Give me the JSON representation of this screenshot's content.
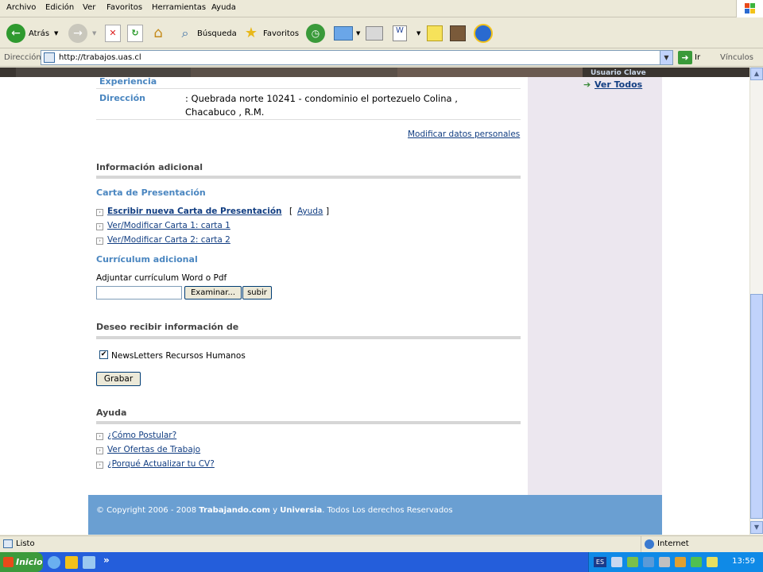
{
  "menu": {
    "items": [
      "Archivo",
      "Edición",
      "Ver",
      "Favoritos",
      "Herramientas",
      "Ayuda"
    ]
  },
  "toolbar": {
    "back_label": "Atrás",
    "search_label": "Búsqueda",
    "favorites_label": "Favoritos"
  },
  "address": {
    "label": "Dirección",
    "url": "http://trabajos.uas.cl",
    "go_label": "Ir",
    "links_label": "Vínculos"
  },
  "banner": {
    "user_clave": "Usuario  Clave"
  },
  "sidebar": {
    "ver_todos": "Ver Todos"
  },
  "profile": {
    "experiencia_label": "Experiencia",
    "direccion_label": "Dirección",
    "direccion_line1": ": Quebrada norte 10241 - condominio el portezuelo Colina ,",
    "direccion_line2": "Chacabuco , R.M.",
    "modificar_link": "Modificar datos personales"
  },
  "info_adicional": {
    "heading": "Información adicional"
  },
  "carta": {
    "heading": "Carta de Presentación",
    "write_link": "Escribir nueva Carta de Presentación",
    "bracket_open": "[",
    "ayuda_link": "Ayuda",
    "bracket_close": "]",
    "carta1_link": "Ver/Modificar Carta 1: carta 1",
    "carta2_link": "Ver/Modificar Carta 2: carta 2"
  },
  "curriculum": {
    "heading": "Currículum adicional",
    "attach_label": "Adjuntar currículum Word o Pdf",
    "file_value": "",
    "examinar_label": "Examinar...",
    "subir_label": "subir"
  },
  "deseo": {
    "heading": "Deseo recibir información de",
    "newsletter_label": "NewsLetters Recursos Humanos",
    "newsletter_checked": true,
    "grabar_label": "Grabar"
  },
  "ayuda": {
    "heading": "Ayuda",
    "links": [
      "¿Cómo Postular?",
      "Ver Ofertas de Trabajo",
      "¿Porqué Actualizar tu CV?"
    ]
  },
  "footer": {
    "prefix": "© Copyright 2006 - 2008 ",
    "brand1": "Trabajando.com",
    "middle": " y ",
    "brand2": "Universia",
    "suffix": ". Todos Los derechos Reservados"
  },
  "status": {
    "text": "Listo",
    "zone": "Internet"
  },
  "taskbar": {
    "start_label": "Inicio",
    "time": "13:59",
    "chevron": "»",
    "lang": "ES"
  },
  "colors": {
    "accent_blue": "#4a86c0",
    "link": "#123e82",
    "footer": "#6a9fd2",
    "sidebar": "#ece7ef"
  }
}
